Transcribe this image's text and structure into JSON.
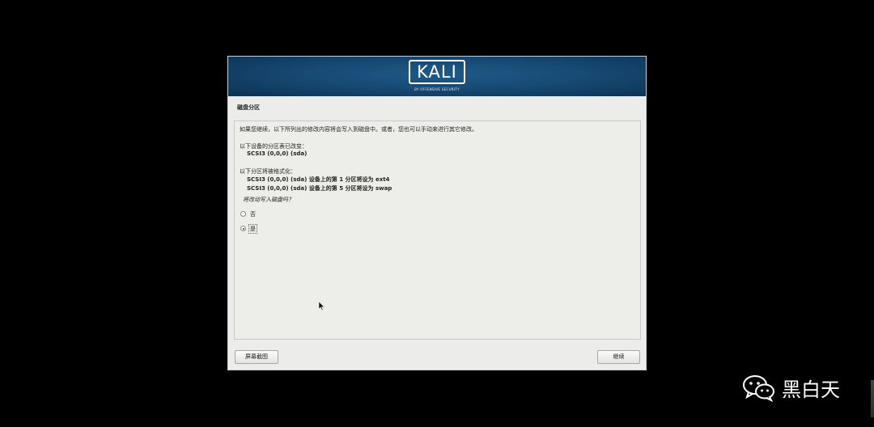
{
  "banner": {
    "logo": "KALI",
    "tagline": "BY OFFENSIVE SECURITY"
  },
  "page_title": "磁盘分区",
  "content": {
    "intro": "如果您继续，以下所列出的修改内容将会写入到磁盘中。或者，您也可以手动来进行其它修改。",
    "changed_label": "以下设备的分区表已改变：",
    "changed_device": "SCSI3 (0,0,0) (sda)",
    "format_label": "以下分区将被格式化：",
    "format_items": [
      "SCSI3 (0,0,0) (sda) 设备上的第 1 分区将设为 ext4",
      "SCSI3 (0,0,0) (sda) 设备上的第 5 分区将设为 swap"
    ],
    "question": "将改动写入磁盘吗？",
    "options": [
      {
        "label": "否",
        "selected": false
      },
      {
        "label": "是",
        "selected": true
      }
    ]
  },
  "buttons": {
    "screenshot": "屏幕截图",
    "continue": "继续"
  },
  "watermark": {
    "text": "黑白天",
    "icon": "wechat-icon"
  }
}
